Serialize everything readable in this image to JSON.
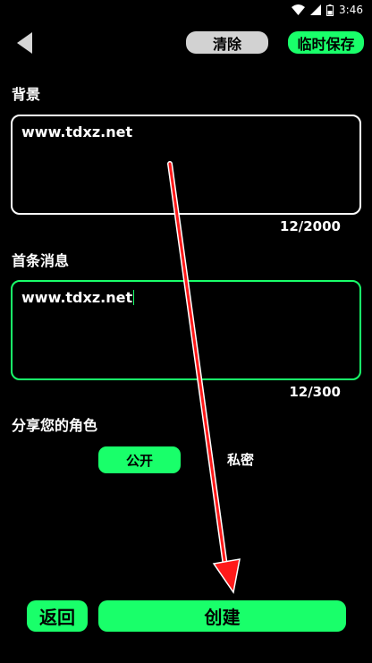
{
  "status_bar": {
    "time": "3:46",
    "icons": [
      "wifi-icon",
      "signal-icon",
      "battery-icon"
    ]
  },
  "toolbar": {
    "back_icon": "back-arrow-icon",
    "clear_label": "清除",
    "save_label": "临时保存"
  },
  "background_section": {
    "label": "背景",
    "value": "www.tdxz.net",
    "counter": "12/2000"
  },
  "first_message_section": {
    "label": "首条消息",
    "value": "www.tdxz.net",
    "counter": "12/300"
  },
  "share_section": {
    "label": "分享您的角色",
    "options": [
      "公开",
      "私密"
    ],
    "selected": "公开"
  },
  "footer": {
    "back_label": "返回",
    "create_label": "创建"
  },
  "colors": {
    "accent": "#19ff6a",
    "background": "#000000",
    "clear_button": "#d2d2d2",
    "annotation_arrow": "#ff0000"
  }
}
